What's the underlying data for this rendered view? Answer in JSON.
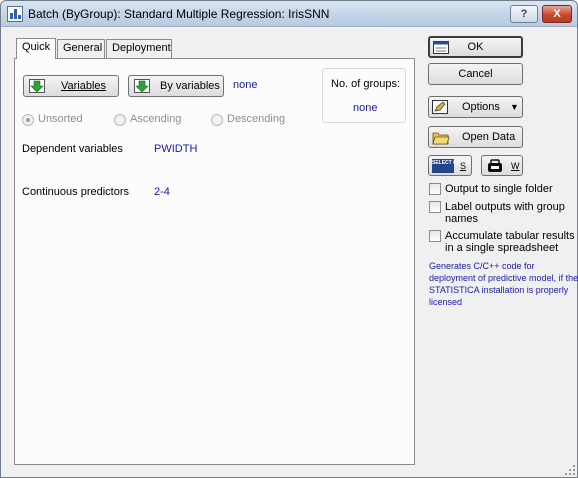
{
  "window": {
    "title": "Batch (ByGroup): Standard Multiple Regression: IrisSNN",
    "help_glyph": "?",
    "close_glyph": "X"
  },
  "tabs": [
    {
      "label": "Quick"
    },
    {
      "label": "General"
    },
    {
      "label": "Deployment"
    }
  ],
  "quick": {
    "variables_button": "Variables",
    "by_variables_button": "By variables",
    "by_value": "none",
    "groups_label": "No. of groups:",
    "groups_value": "none",
    "sort_options": [
      "Unsorted",
      "Ascending",
      "Descending"
    ],
    "dependent_label": "Dependent variables",
    "dependent_value": "PWIDTH",
    "predictors_label": "Continuous predictors",
    "predictors_value": "2-4"
  },
  "side": {
    "ok": "OK",
    "cancel": "Cancel",
    "options": "Options",
    "open_data": "Open Data",
    "select_cases_icon_text": "SELECT CASES",
    "select_cases_key": "S",
    "weight_key": "W",
    "checkboxes": [
      "Output to single folder",
      "Label outputs with group names",
      "Accumulate tabular results in a single spreadsheet"
    ],
    "deploy_note": "Generates C/C++ code for deployment of predictive model, if the STATISTICA installation is properly licensed"
  },
  "colors": {
    "link": "#1a1aa8",
    "arrow_green": "#2fa23a",
    "title_bar": "#c3d3e6"
  }
}
